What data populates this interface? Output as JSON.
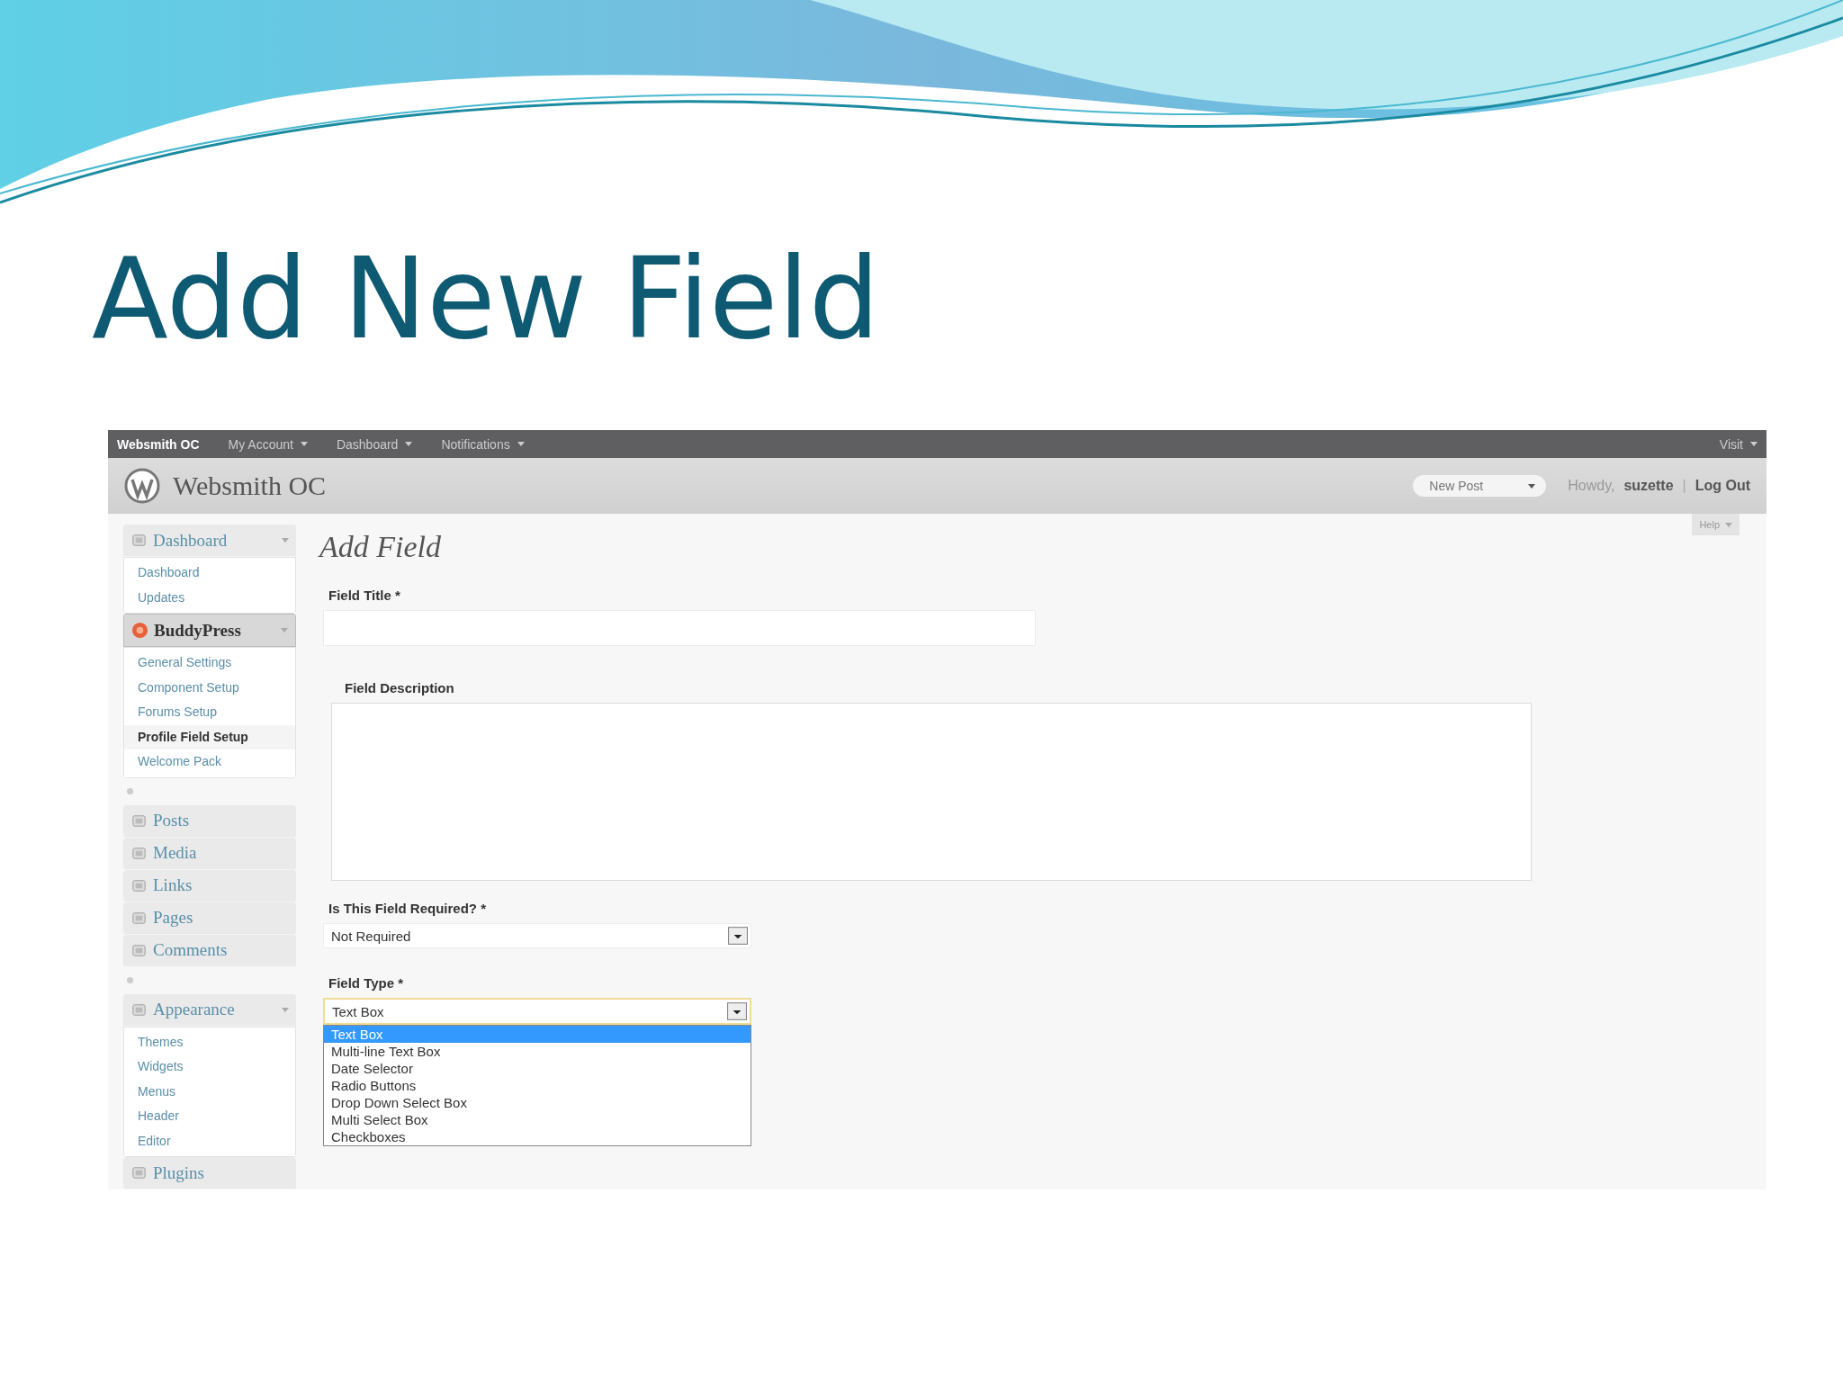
{
  "slide": {
    "title": "Add New Field"
  },
  "admin_bar": {
    "site": "Websmith OC",
    "menus": [
      {
        "label": "My Account"
      },
      {
        "label": "Dashboard"
      },
      {
        "label": "Notifications"
      }
    ],
    "visit": "Visit"
  },
  "header": {
    "site_title": "Websmith OC",
    "new_post": "New Post",
    "howdy": "Howdy,",
    "user": "suzette",
    "separator": "|",
    "logout": "Log Out",
    "help": "Help"
  },
  "sidebar": [
    {
      "kind": "menu",
      "label": "Dashboard",
      "expanded": true,
      "current": false,
      "items": [
        {
          "label": "Dashboard",
          "selected": false
        },
        {
          "label": "Updates",
          "selected": false
        }
      ]
    },
    {
      "kind": "menu",
      "label": "BuddyPress",
      "expanded": true,
      "current": true,
      "items": [
        {
          "label": "General Settings",
          "selected": false
        },
        {
          "label": "Component Setup",
          "selected": false
        },
        {
          "label": "Forums Setup",
          "selected": false
        },
        {
          "label": "Profile Field Setup",
          "selected": true
        },
        {
          "label": "Welcome Pack",
          "selected": false
        }
      ]
    },
    {
      "kind": "separator"
    },
    {
      "kind": "menu",
      "label": "Posts",
      "expanded": false,
      "current": false
    },
    {
      "kind": "menu",
      "label": "Media",
      "expanded": false,
      "current": false
    },
    {
      "kind": "menu",
      "label": "Links",
      "expanded": false,
      "current": false
    },
    {
      "kind": "menu",
      "label": "Pages",
      "expanded": false,
      "current": false
    },
    {
      "kind": "menu",
      "label": "Comments",
      "expanded": false,
      "current": false
    },
    {
      "kind": "separator"
    },
    {
      "kind": "menu",
      "label": "Appearance",
      "expanded": true,
      "current": false,
      "items": [
        {
          "label": "Themes",
          "selected": false
        },
        {
          "label": "Widgets",
          "selected": false
        },
        {
          "label": "Menus",
          "selected": false
        },
        {
          "label": "Header",
          "selected": false
        },
        {
          "label": "Editor",
          "selected": false
        }
      ]
    },
    {
      "kind": "menu",
      "label": "Plugins",
      "expanded": false,
      "current": false
    }
  ],
  "page_title": "Add Field",
  "fields": [
    {
      "kind": "text",
      "label": "Field Title *"
    },
    {
      "kind": "textarea",
      "label": "Field Description"
    },
    {
      "kind": "select",
      "label": "Is This Field Required? *",
      "value": "Not Required",
      "open": false
    },
    {
      "kind": "select",
      "label": "Field Type *",
      "value": "Text Box",
      "open": true,
      "options": [
        {
          "label": "Text Box",
          "selected": true
        },
        {
          "label": "Multi-line Text Box",
          "selected": false
        },
        {
          "label": "Date Selector",
          "selected": false
        },
        {
          "label": "Radio Buttons",
          "selected": false
        },
        {
          "label": "Drop Down Select Box",
          "selected": false
        },
        {
          "label": "Multi Select Box",
          "selected": false
        },
        {
          "label": "Checkboxes",
          "selected": false
        }
      ]
    }
  ]
}
